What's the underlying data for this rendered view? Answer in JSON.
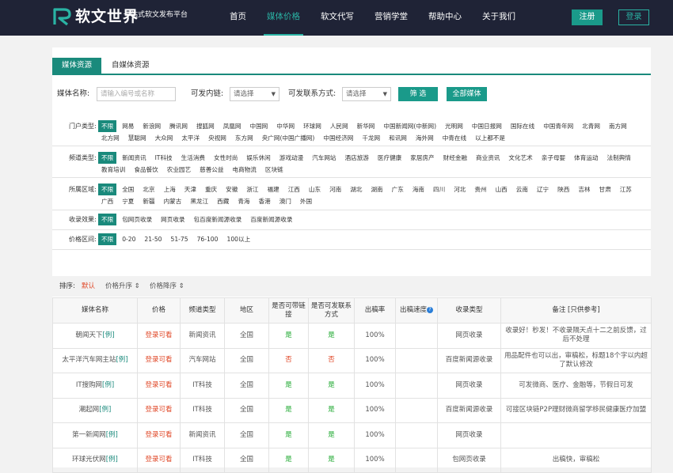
{
  "header": {
    "logo_text": "软文世界",
    "slogan": "一站式软文发布平台",
    "nav": [
      {
        "label": "首页",
        "active": false
      },
      {
        "label": "媒体价格",
        "active": true
      },
      {
        "label": "软文代写",
        "active": false
      },
      {
        "label": "营销学堂",
        "active": false
      },
      {
        "label": "帮助中心",
        "active": false
      },
      {
        "label": "关于我们",
        "active": false
      }
    ],
    "register_label": "注册",
    "login_label": "登录"
  },
  "tabs": [
    "媒体资源",
    "自媒体资源"
  ],
  "search": {
    "name_label": "媒体名称:",
    "name_placeholder": "请输入编号或名称",
    "link_label": "可发内链:",
    "link_value": "请选择",
    "contact_label": "可发联系方式:",
    "contact_value": "请选择",
    "filter_button": "筛 选",
    "all_button": "全部媒体"
  },
  "filters": [
    {
      "label": "门户类型:",
      "options": [
        "不限",
        "网易",
        "新浪网",
        "腾讯网",
        "搜狐网",
        "凤凰网",
        "中国网",
        "中华网",
        "环球网",
        "人民网",
        "新华网",
        "中国新闻网(中新网)",
        "光明网",
        "中国日报网",
        "国际在线",
        "中国青年网",
        "北青网",
        "南方网",
        "北方网",
        "慧聪网",
        "大众网",
        "太平洋",
        "央视网",
        "东方网",
        "央广网(中国广播网)",
        "中国经济网",
        "千龙网",
        "和讯网",
        "海外网",
        "中青在线",
        "以上都不是"
      ]
    },
    {
      "label": "频道类型:",
      "options": [
        "不限",
        "新闻资讯",
        "IT科技",
        "生活消费",
        "女性时尚",
        "娱乐休闲",
        "游戏动漫",
        "汽车网站",
        "酒店旅游",
        "医疗健康",
        "家居房产",
        "财经金融",
        "商业资讯",
        "文化艺术",
        "亲子母婴",
        "体育运动",
        "法制舆情",
        "教育培训",
        "食品餐饮",
        "农业园艺",
        "慈善公益",
        "电商物流",
        "区块链"
      ]
    },
    {
      "label": "所属区域:",
      "options": [
        "不限",
        "全国",
        "北京",
        "上海",
        "天津",
        "重庆",
        "安徽",
        "浙江",
        "福建",
        "江西",
        "山东",
        "河南",
        "湖北",
        "湖南",
        "广东",
        "海南",
        "四川",
        "河北",
        "贵州",
        "山西",
        "云南",
        "辽宁",
        "陕西",
        "吉林",
        "甘肃",
        "江苏",
        "广西",
        "宁夏",
        "新疆",
        "内蒙古",
        "黑龙江",
        "西藏",
        "青海",
        "香港",
        "澳门",
        "外国"
      ]
    },
    {
      "label": "收录效果:",
      "options": [
        "不限",
        "包网页收录",
        "网页收录",
        "包百度新闻源收录",
        "百度新闻源收录"
      ]
    },
    {
      "label": "价格区间:",
      "options": [
        "不限",
        "0-20",
        "21-50",
        "51-75",
        "76-100",
        "100以上"
      ]
    }
  ],
  "sort": {
    "label": "排序:",
    "default": "默认",
    "asc": "价格升序 ⇕",
    "desc": "价格降序 ⇕"
  },
  "table": {
    "headers": [
      "媒体名称",
      "价格",
      "频道类型",
      "地区",
      "是否可带链接",
      "是否可发联系方式",
      "出稿率",
      "出稿速度",
      "收录类型",
      "备注 [只供参考]"
    ],
    "help_icon": "?",
    "rows": [
      {
        "name": "朝闻天下",
        "tag": "[例]",
        "price": "登录可看",
        "channel": "新闻资讯",
        "region": "全国",
        "link": "是",
        "contact": "是",
        "rate": "100%",
        "speed": "",
        "index": "网页收录",
        "note": "收录好！秒发！不收录隔天点十二之前反馈，过后不处理"
      },
      {
        "name": "太平洋汽车网主站",
        "tag": "[例]",
        "price": "登录可看",
        "channel": "汽车网站",
        "region": "全国",
        "link": "否",
        "contact": "否",
        "rate": "100%",
        "speed": "",
        "index": "百度新闻源收录",
        "note": "用品配件也可以出，审稿松，标题18个字以内超了默认修改"
      },
      {
        "name": "IT搜购网",
        "tag": "[例]",
        "price": "登录可看",
        "channel": "IT科技",
        "region": "全国",
        "link": "是",
        "contact": "是",
        "rate": "100%",
        "speed": "",
        "index": "网页收录",
        "note": "可发微商、医疗、金融等，节假日可发"
      },
      {
        "name": "潮起网",
        "tag": "[例]",
        "price": "登录可看",
        "channel": "IT科技",
        "region": "全国",
        "link": "是",
        "contact": "是",
        "rate": "100%",
        "speed": "",
        "index": "百度新闻源收录",
        "note": "可接区块链P2P理财微商留学移民健康医疗加盟"
      },
      {
        "name": "第一新闻网",
        "tag": "[例]",
        "price": "登录可看",
        "channel": "新闻资讯",
        "region": "全国",
        "link": "是",
        "contact": "是",
        "rate": "100%",
        "speed": "",
        "index": "网页收录",
        "note": ""
      },
      {
        "name": "环球光伏网",
        "tag": "[例]",
        "price": "登录可看",
        "channel": "IT科技",
        "region": "全国",
        "link": "是",
        "contact": "是",
        "rate": "100%",
        "speed": "",
        "index": "包网页收录",
        "note": "出稿快，审稿松"
      }
    ]
  },
  "colors": {
    "header_bg": "#1f2336",
    "accent": "#1a8a7c",
    "price": "#e04a2a",
    "yes": "#22aa33",
    "no": "#e04a2a"
  }
}
